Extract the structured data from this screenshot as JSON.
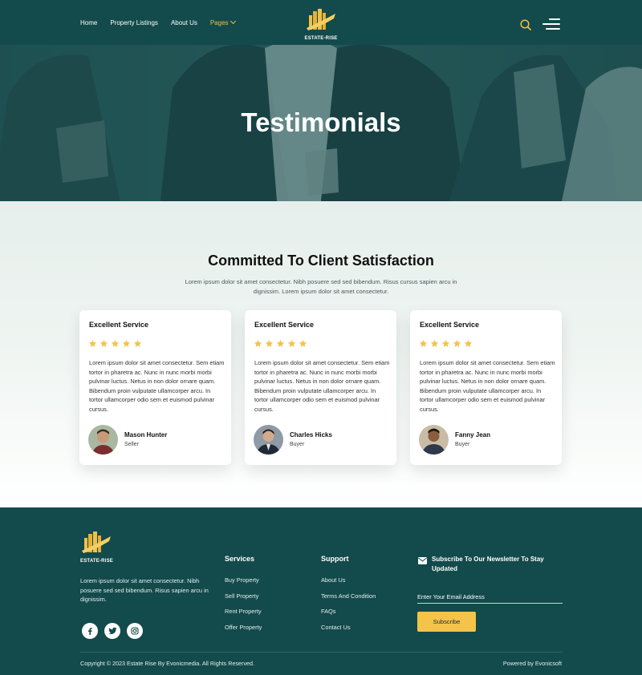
{
  "header": {
    "nav": [
      {
        "label": "Home"
      },
      {
        "label": "Property Listings"
      },
      {
        "label": "About Us"
      },
      {
        "label": "Pages"
      }
    ],
    "logo_text": "ESTATE-RISE",
    "icons": {
      "search": "search-icon",
      "menu": "menu-icon"
    }
  },
  "hero": {
    "title": "Testimonials"
  },
  "testimonials": {
    "title": "Committed To Client Satisfaction",
    "subtitle": "Lorem ipsum dolor sit amet consectetur. Nibh posuere sed sed bibendum. Risus cursus sapien arcu in dignissim. Lorem ipsum dolor sit amet consectetur.",
    "rating": 5,
    "cards": [
      {
        "title": "Excellent Service",
        "text": "Lorem ipsum dolor sit amet consectetur. Sem etiam tortor in pharetra ac. Nunc in nunc morbi morbi pulvinar luctus. Netus in non dolor ornare quam. Bibendum proin vulputate ullamcorper arcu. In tortor ullamcorper odio sem et euismod pulvinar cursus.",
        "name": "Mason Hunter",
        "role": "Seller"
      },
      {
        "title": "Excellent Service",
        "text": "Lorem ipsum dolor sit amet consectetur. Sem etiam tortor in pharetra ac. Nunc in nunc morbi morbi pulvinar luctus. Netus in non dolor ornare quam. Bibendum proin vulputate ullamcorper arcu. In tortor ullamcorper odio sem et euismod pulvinar cursus.",
        "name": "Charles Hicks",
        "role": "Buyer"
      },
      {
        "title": "Excellent Service",
        "text": "Lorem ipsum dolor sit amet consectetur. Sem etiam tortor in pharetra ac. Nunc in nunc morbi morbi pulvinar luctus. Netus in non dolor ornare quam. Bibendum proin vulputate ullamcorper arcu. In tortor ullamcorper odio sem et euismod pulvinar cursus.",
        "name": "Fanny Jean",
        "role": "Buyer"
      }
    ]
  },
  "footer": {
    "logo_text": "ESTATE-RISE",
    "description": "Lorem ipsum dolor sit amet consectetur. Nibh posuere sed sed bibendum. Risus sapien arcu in dignissim.",
    "social_icons": [
      "facebook-icon",
      "twitter-icon",
      "instagram-icon"
    ],
    "services": {
      "title": "Services",
      "links": [
        "Buy Property",
        "Sell Property",
        "Rent Property",
        "Offer Property"
      ]
    },
    "support": {
      "title": "Support",
      "links": [
        "About Us",
        "Terms And Condition",
        "FAQs",
        "Contact Us"
      ]
    },
    "newsletter": {
      "title": "Subscribe To Our Newsletter To Stay Updated",
      "placeholder": "Enter Your Email Address",
      "button": "Subscribe"
    },
    "copyright": "Copyright © 2023 Estate Rise By Evonicmedia. All Rights Reserved.",
    "powered": "Powered by Evonicsoft"
  },
  "colors": {
    "primary": "#134a4b",
    "accent": "#f4c34a",
    "star": "#f4c34a"
  }
}
